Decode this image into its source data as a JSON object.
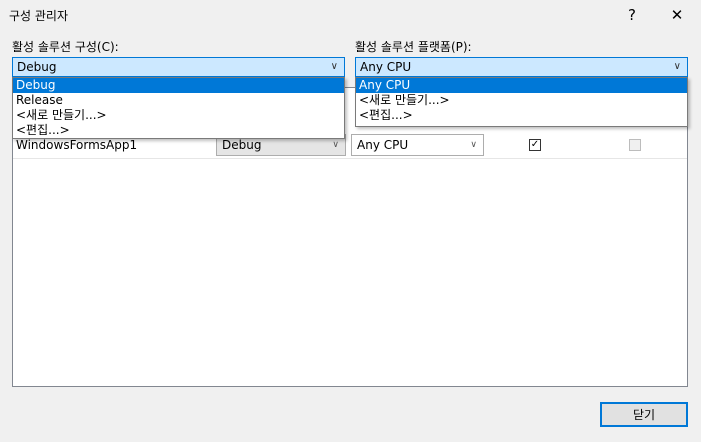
{
  "window": {
    "title": "구성 관리자",
    "help_label": "?",
    "close_label": "✕"
  },
  "solution_config": {
    "label": "활성 솔루션 구성(C):",
    "value": "Debug",
    "options": [
      "Debug",
      "Release",
      "<새로 만들기...>",
      "<편집...>"
    ]
  },
  "solution_platform": {
    "label": "활성 솔루션 플랫폼(P):",
    "value": "Any CPU",
    "options": [
      "Any CPU",
      "<새로 만들기...>",
      "<편집...>"
    ]
  },
  "projects": {
    "rows": [
      {
        "project": "WindowsFormsApp1",
        "config": "Debug",
        "platform": "Any CPU",
        "build": true,
        "deploy": false
      }
    ]
  },
  "icons": {
    "dropdown_arrow": "chevron-down-icon",
    "check": "checkmark-icon"
  },
  "footer": {
    "close_button": "닫기"
  }
}
